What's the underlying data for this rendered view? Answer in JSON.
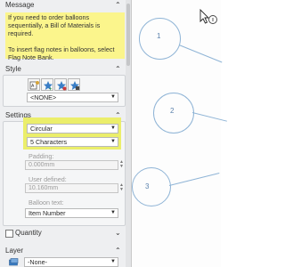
{
  "message": {
    "title": "Message",
    "line1": "If you need to order balloons",
    "line2": "sequentially, a Bill of Materials is",
    "line3": "required.",
    "line4": "To insert flag notes in balloons, select",
    "line5": "Flag Note Bank."
  },
  "style": {
    "title": "Style",
    "icons": [
      "balloon-style-icon",
      "add-style-icon",
      "update-style-icon",
      "save-style-icon"
    ],
    "select_value": "<NONE>"
  },
  "settings": {
    "title": "Settings",
    "style_value": "Circular",
    "size_value": "5 Characters",
    "padding_label": "Padding:",
    "padding_value": "0.000mm",
    "user_defined_label": "User defined:",
    "user_defined_value": "10.160mm",
    "balloon_text_label": "Balloon text:",
    "balloon_text_value": "Item Number"
  },
  "quantity": {
    "label": "Quantity"
  },
  "layer": {
    "title": "Layer",
    "select_value": "-None-"
  },
  "canvas": {
    "balloons": [
      "1",
      "2",
      "3"
    ]
  },
  "colors": {
    "highlight": "#ebee6b",
    "message_bg": "#fbf58c",
    "balloon_stroke": "#8fb4d6"
  }
}
